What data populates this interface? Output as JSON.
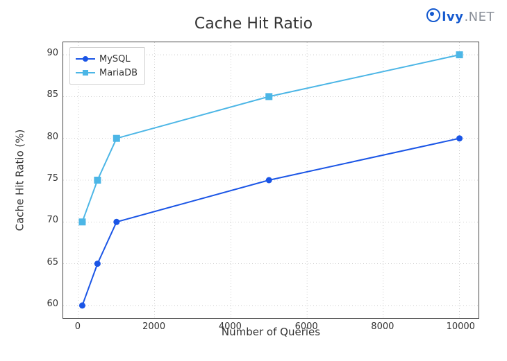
{
  "watermark": {
    "brand1": "lvy",
    "brand2": ".NET"
  },
  "chart_data": {
    "type": "line",
    "title": "Cache Hit Ratio",
    "xlabel": "Number of Queries",
    "ylabel": "Cache Hit Ratio (%)",
    "x": [
      100,
      500,
      1000,
      5000,
      10000
    ],
    "xlim": [
      -400,
      10500
    ],
    "ylim": [
      58.5,
      91.5
    ],
    "xticks": [
      0,
      2000,
      4000,
      6000,
      8000,
      10000
    ],
    "yticks": [
      60,
      65,
      70,
      75,
      80,
      85,
      90
    ],
    "series": [
      {
        "name": "MySQL",
        "values": [
          60,
          65,
          70,
          75,
          80
        ],
        "color": "#1a55e6",
        "marker": "circle"
      },
      {
        "name": "MariaDB",
        "values": [
          70,
          75,
          80,
          85,
          90
        ],
        "color": "#4cb6e6",
        "marker": "square"
      }
    ],
    "legend_position": "upper-left",
    "grid": true
  }
}
